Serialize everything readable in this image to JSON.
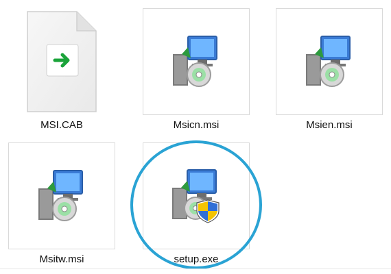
{
  "files": [
    {
      "name": "MSI.CAB",
      "icon": "cab-file-icon"
    },
    {
      "name": "Msicn.msi",
      "icon": "installer-package-icon"
    },
    {
      "name": "Msien.msi",
      "icon": "installer-package-icon"
    },
    {
      "name": "Msitw.msi",
      "icon": "installer-package-icon"
    },
    {
      "name": "setup.exe",
      "icon": "setup-shield-icon"
    }
  ],
  "highlight": {
    "target": "setup.exe",
    "color": "#2aa3d4"
  }
}
